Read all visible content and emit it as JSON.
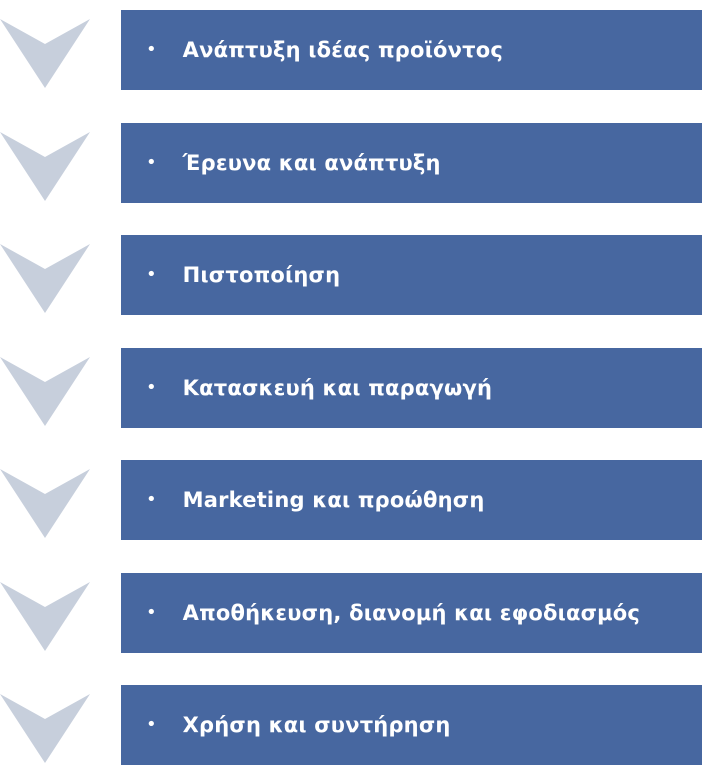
{
  "colors": {
    "band": "#4767a0",
    "chevron": "#c7cfdc",
    "text": "#ffffff"
  },
  "icons": {
    "chevron": "chevron-down-icon",
    "bullet": "bullet-icon"
  },
  "steps": [
    {
      "label": "Ανάπτυξη ιδέας προϊόντος"
    },
    {
      "label": "Έρευνα και ανάπτυξη"
    },
    {
      "label": "Πιστοποίηση"
    },
    {
      "label": "Κατασκευή και παραγωγή"
    },
    {
      "label": "Marketing και προώθηση"
    },
    {
      "label": "Αποθήκευση, διανομή και εφοδιασμός"
    },
    {
      "label": "Χρήση και συντήρηση"
    }
  ]
}
